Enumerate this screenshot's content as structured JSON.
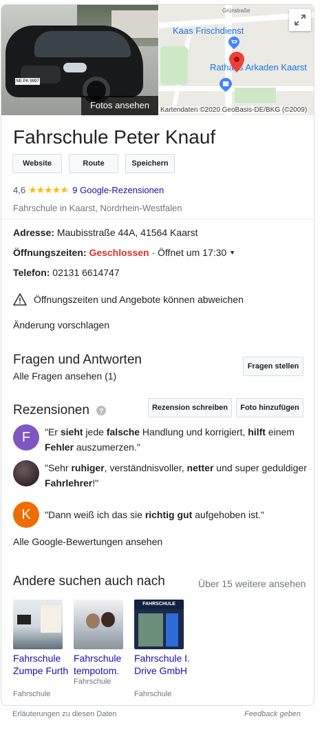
{
  "hero": {
    "photos_button": "Fotos ansehen",
    "plate": "NE·PK 9997",
    "map": {
      "street": "Grünstraße",
      "poi1": "Kaas Frischdienst",
      "poi2": "Rathaus Arkaden Kaarst",
      "attribution": "Kartendaten ©2020 GeoBasis-DE/BKG (©2009)"
    }
  },
  "business": {
    "name": "Fahrschule Peter Knauf",
    "buttons": [
      "Website",
      "Route",
      "Speichern"
    ],
    "rating": "4,6",
    "stars_value": 4.6,
    "reviews_link": "9 Google-Rezensionen",
    "category": "Fahrschule in Kaarst, Nordrhein-Westfalen"
  },
  "details": {
    "address_label": "Adresse:",
    "address": "Maubisstraße 44A, 41564 Kaarst",
    "hours_label": "Öffnungszeiten:",
    "hours_status": "Geschlossen",
    "hours_next": " · Öffnet um 17:30",
    "phone_label": "Telefon:",
    "phone": "02131 6614747",
    "warning": "Öffnungszeiten und Angebote können abweichen",
    "suggest_edit": "Änderung vorschlagen"
  },
  "qa": {
    "title": "Fragen und Antworten",
    "all_link": "Alle Fragen ansehen (1)",
    "ask_button": "Fragen stellen"
  },
  "reviews": {
    "title": "Rezensionen",
    "write_button": "Rezension schreiben",
    "photo_button": "Foto hinzufügen",
    "items": [
      {
        "initial": "F",
        "color": "#7e57c2",
        "html": "\"Er <b>sieht</b> jede <b>falsche</b> Handlung und korrigiert, <b>hilft</b> einem <b>Fehler</b> auszumerzen.\""
      },
      {
        "initial": "",
        "color": "#2a1f22",
        "html": "\"Sehr <b>ruhiger</b>, verständnisvoller, <b>netter</b> und super geduldiger <b>Fahrlehrer</b>!\""
      },
      {
        "initial": "K",
        "color": "#ef6c00",
        "html": "\"Dann weiß ich das sie <b>richtig gut</b> aufgehoben ist.\""
      }
    ],
    "all_link": "Alle Google-Bewertungen ansehen"
  },
  "also_search": {
    "title": "Andere suchen auch nach",
    "more_link": "Über 15 weitere ansehen",
    "items": [
      {
        "name": "Fahrschule Zumpe Furth",
        "category": "Fahrschule"
      },
      {
        "name": "Fahrschule tempotom.",
        "category": "Fahrschule"
      },
      {
        "name": "Fahrschule I. Drive GmbH",
        "category": "Fahrschule"
      }
    ],
    "sign_text": "FAHRSCHULE"
  },
  "footer": {
    "explain": "Erläuterungen zu diesen Daten",
    "feedback": "Feedback geben"
  }
}
